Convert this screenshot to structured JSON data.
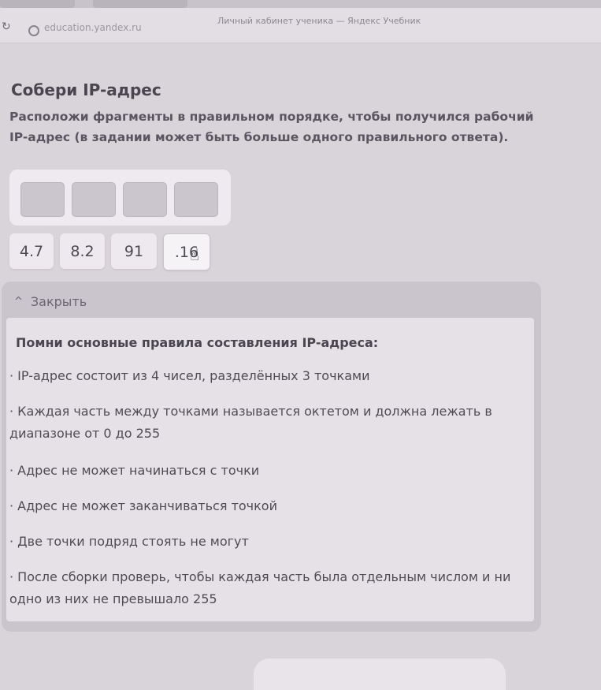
{
  "browser": {
    "url": "education.yandex.ru",
    "window_title": "Личный кабинет ученика — Яндекс Учебник",
    "back_icon": "back-arrow-icon",
    "site_icon": "site-icon"
  },
  "task": {
    "title": "Собери IP-адрес",
    "description": "Расположи фрагменты в правильном порядке, чтобы получился рабочий IP-адрес (в задании может быть больше одного правильного ответа).",
    "slots_count": 4,
    "fragments": [
      "4.7",
      "8.2",
      "91",
      ".16"
    ],
    "hovered_fragment": ".16"
  },
  "hint": {
    "toggle_label": "Закрыть",
    "heading": "Помни основные правила составления IP-адреса:",
    "rules": [
      "· IP-адрес состоит из 4 чисел, разделённых 3 точками",
      "· Каждая часть между точками называется октетом и должна лежать в диапазоне от 0 до 255",
      "· Адрес не может начинаться с точки",
      "· Адрес не может заканчиваться точкой",
      "· Две точки подряд стоять не могут",
      "· После сборки проверь, чтобы каждая часть была отдельным числом и ни одно из них не превышало 255"
    ]
  }
}
